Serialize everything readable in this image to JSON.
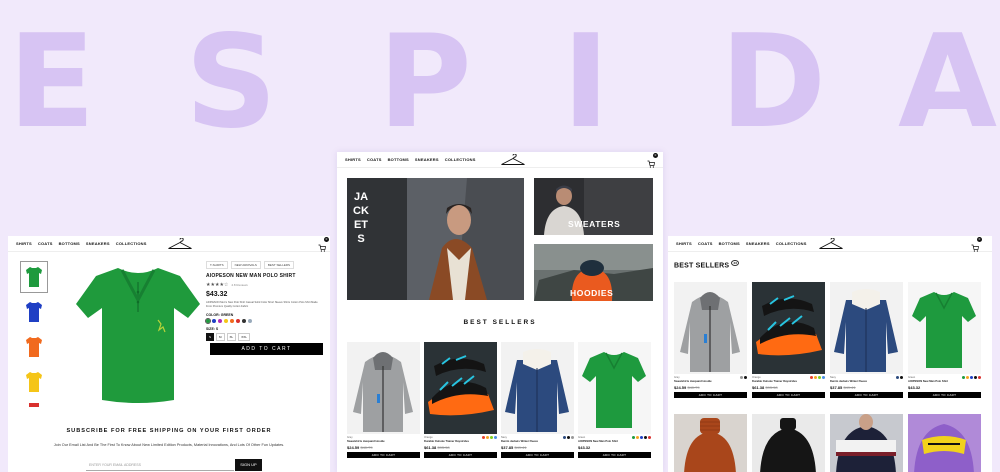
{
  "background_letters": [
    "E",
    "S",
    "P",
    "I",
    "D",
    "A"
  ],
  "colors": {
    "background": "#f1e9fb",
    "letters": "#d7c4f3",
    "accent_black": "#000000"
  },
  "nav": {
    "items": [
      "SHIRTS",
      "COATS",
      "BOTTOMS",
      "SNEAKERS",
      "COLLECTIONS"
    ],
    "logo_icon": "hanger-icon",
    "cart_icon": "cart-icon",
    "cart_count": "0"
  },
  "product_page": {
    "breadcrumbs": [
      "T-SHIRTS",
      "NEW ARRIVALS",
      "BEST SELLERS"
    ],
    "title": "AIOPESON NEW MAN POLO SHIRT",
    "rating": "★★★★☆",
    "reviews": "4.8 Reviews",
    "price": "$43.32",
    "description": "AIOPESON Men's New Polo Shirt Casual Solid Color Short Sleeve Shirts Cotton Polo Shirt Made From Premium Quality Cotton Fabric",
    "color_label": "COLOR: GREEN",
    "sizes_label": "SIZE: S",
    "sizes": [
      "S",
      "M",
      "XL",
      "XXL"
    ],
    "add_to_cart": "ADD TO CART",
    "subscribe_title": "SUBSCRIBE FOR FREE SHIPPING ON YOUR FIRST ORDER",
    "subscribe_text": "Join Our Email List And Be The First To Know About New Limited Edition Products, Material Innovations, And Lots Of Other Fun Updates.",
    "email_placeholder": "ENTER YOUR EMAIL ADDRESS",
    "signup": "SIGN UP"
  },
  "home": {
    "hero_label": "JACKETS",
    "tiles": [
      "SWEATERS",
      "HOODIES"
    ],
    "best_sellers_title": "BEST SELLERS",
    "products": [
      {
        "cat": "Grey",
        "name": "Sweatshirts Jacquard Hoodie",
        "price": "$24.59",
        "old": "$40.79",
        "btn": "ADD TO CART"
      },
      {
        "cat": "Orange",
        "name": "Durable Outsole Trainer Daystrides",
        "price": "$61.38",
        "old": "$93.98",
        "btn": "ADD TO CART"
      },
      {
        "cat": "Navy",
        "name": "Denim Jackets Winter Fleece",
        "price": "$37.85",
        "old": "$49.41",
        "btn": "ADD TO CART"
      },
      {
        "cat": "Green",
        "name": "AIOPESON New Man Polo Shirt",
        "price": "$43.32",
        "old": "",
        "btn": "ADD TO CART"
      }
    ]
  },
  "listing": {
    "title": "BEST SELLERS",
    "count": "26"
  }
}
